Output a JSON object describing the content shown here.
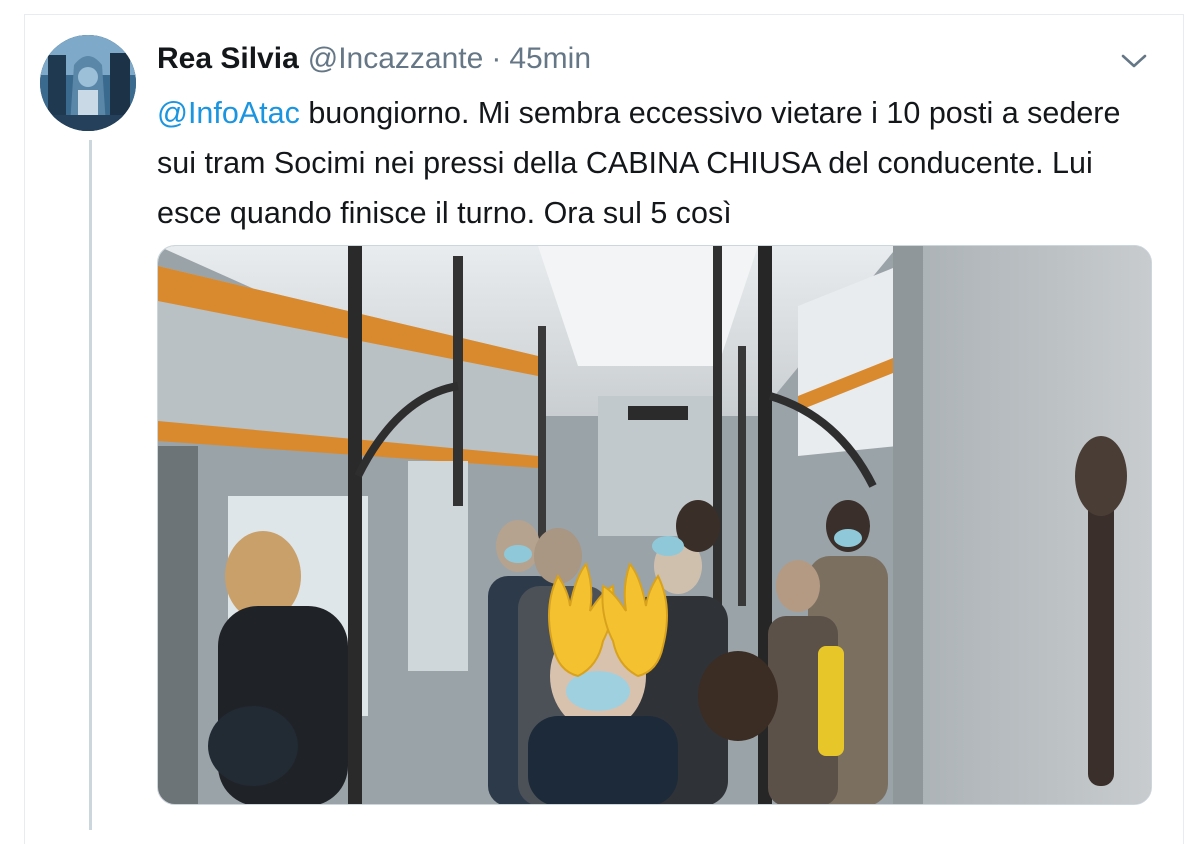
{
  "tweet": {
    "display_name": "Rea Silvia",
    "handle": "@Incazzante",
    "separator": "·",
    "timestamp": "45min",
    "mention": "@InfoAtac",
    "text_after_mention": " buongiorno. Mi sembra eccessivo vietare i 10 posti a sedere sui tram Socimi nei pressi della CABINA CHIUSA del conducente. Lui esce quando finisce il turno. Ora sul 5 così",
    "menu_icon": "chevron-down-icon"
  },
  "media": {
    "kind": "photo",
    "overlay_icon": "raised-hands-emoji"
  },
  "colors": {
    "link": "#1b95e0",
    "secondary_text": "#657786",
    "thread_line": "#ccd6dd",
    "border": "#e6ecf0"
  }
}
